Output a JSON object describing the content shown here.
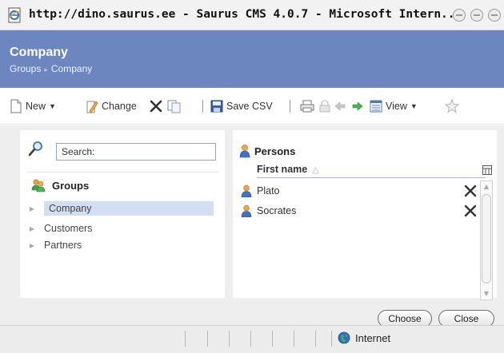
{
  "window": {
    "title": "http://dino.saurus.ee - Saurus CMS 4.0.7 - Microsoft Intern...",
    "icon": "ie-page-icon"
  },
  "header": {
    "title": "Company",
    "breadcrumb": [
      "Groups",
      "Company"
    ]
  },
  "toolbar": {
    "new_label": "New",
    "change_label": "Change",
    "save_csv_label": "Save CSV",
    "view_label": "View"
  },
  "left_panel": {
    "search_value": "Search:",
    "groups_label": "Groups",
    "tree": [
      {
        "label": "Company",
        "selected": true
      },
      {
        "label": "Customers",
        "selected": false
      },
      {
        "label": "Partners",
        "selected": false
      }
    ]
  },
  "right_panel": {
    "title": "Persons",
    "column_header": "First name",
    "sort_indicator": "△",
    "persons": [
      "Plato",
      "Socrates"
    ]
  },
  "buttons": {
    "choose": "Choose",
    "close": "Close"
  },
  "statusbar": {
    "zone": "Internet"
  },
  "colors": {
    "header_bg": "#6c86c0",
    "selection": "#d2dff3",
    "panel_bg": "#eeeeee"
  }
}
